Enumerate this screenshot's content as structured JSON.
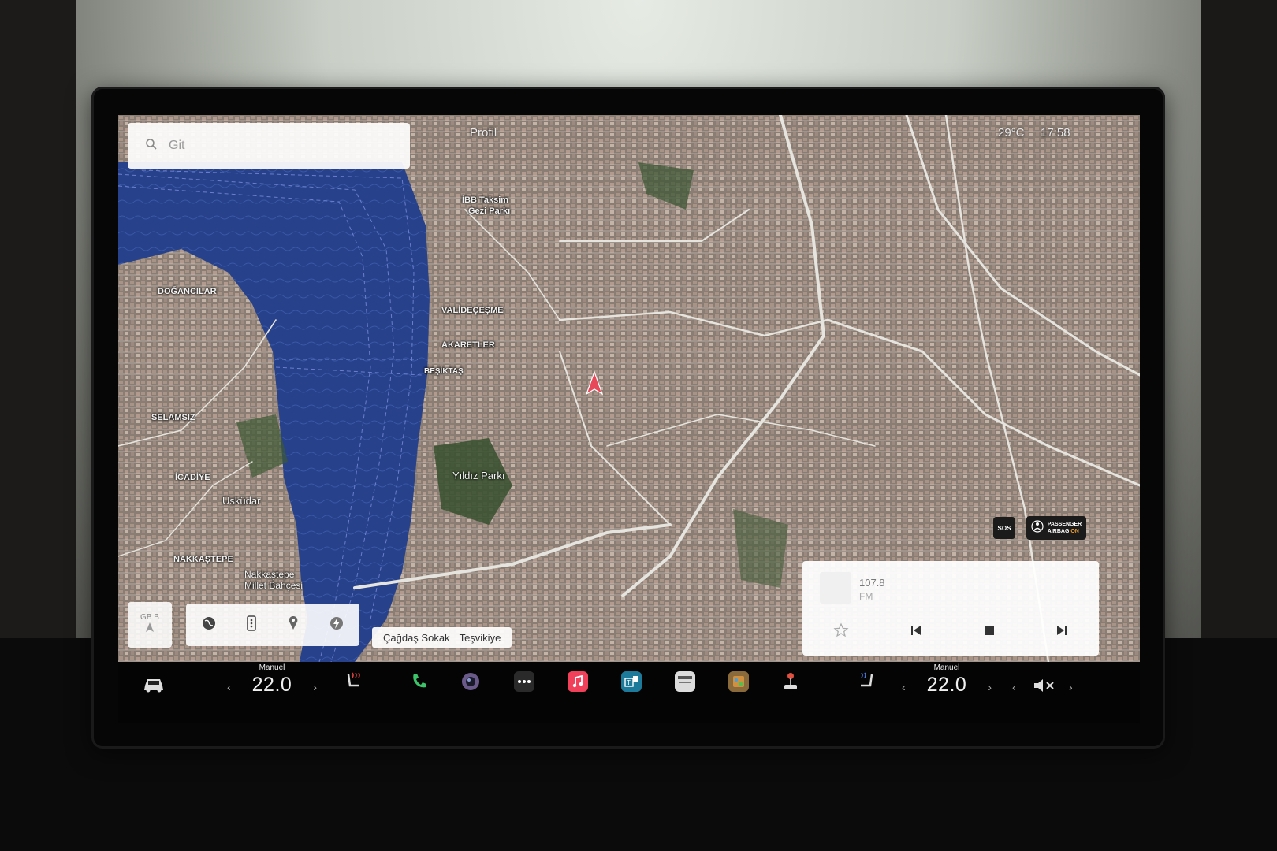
{
  "search": {
    "placeholder": "Git"
  },
  "top_status": {
    "profile": "Profil",
    "temperature": "29°C",
    "time": "17:58"
  },
  "map_labels": [
    {
      "text": "İBB Taksim",
      "cls": ""
    },
    {
      "text": "Gezi Parkı",
      "cls": ""
    },
    {
      "text": "DOĞANCILAR",
      "cls": ""
    },
    {
      "text": "VALİDEÇEŞME",
      "cls": ""
    },
    {
      "text": "AKARETLER",
      "cls": ""
    },
    {
      "text": "BEŞİKTAŞ",
      "cls": ""
    },
    {
      "text": "SELAMSIZ",
      "cls": ""
    },
    {
      "text": "Yıldız Parkı",
      "cls": "big"
    },
    {
      "text": "İCADİYE",
      "cls": ""
    },
    {
      "text": "Üsküdar",
      "cls": "big"
    },
    {
      "text": "NAKKAŞTEPE",
      "cls": ""
    },
    {
      "text": "Nakkaştepe",
      "cls": "big"
    },
    {
      "text": "Millet Bahçesi",
      "cls": "big"
    }
  ],
  "compass": {
    "heading": "GB B"
  },
  "street": {
    "name": "Çağdaş Sokak",
    "district": "Teşvikiye"
  },
  "safety": {
    "sos": "SOS",
    "airbag_line1": "PASSENGER",
    "airbag_line2": "AIRBAG",
    "airbag_state": "ON"
  },
  "media": {
    "frequency": "107.8",
    "band": "FM"
  },
  "climate": {
    "driver": {
      "mode": "Manuel",
      "temp": "22.0"
    },
    "passenger": {
      "mode": "Manuel",
      "temp": "22.0"
    }
  },
  "colors": {
    "nav_arrow": "#e8495a",
    "airbag_on": "#f0a030",
    "music_app": "#f0405a",
    "phone_app": "#3cc46a"
  },
  "icons": [
    "search-icon",
    "car-icon",
    "seat-heater-icon",
    "phone-icon",
    "camera-icon",
    "more-apps-icon",
    "music-icon",
    "toybox-icon",
    "calendar-icon",
    "arcade-icon",
    "joystick-icon",
    "passenger-seat-heater-icon",
    "volume-mute-icon",
    "globe-icon",
    "options-icon",
    "pin-icon",
    "charging-icon",
    "star-icon",
    "prev-icon",
    "stop-icon",
    "next-icon"
  ]
}
